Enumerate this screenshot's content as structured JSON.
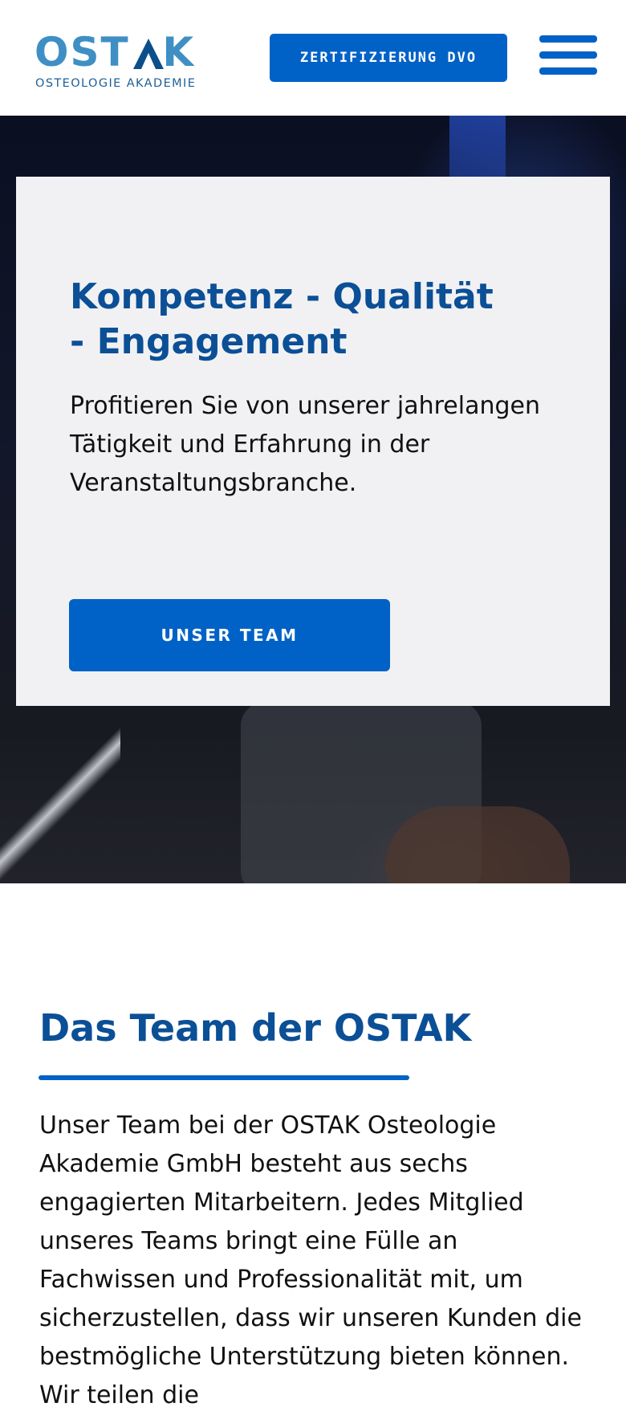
{
  "header": {
    "logo_word": "OSTAK",
    "logo_sub": "OSTEOLOGIE AKADEMIE",
    "cta_label": "ZERTIFIZIERUNG DVO",
    "menu_icon": "hamburger-menu-icon"
  },
  "hero": {
    "title": "Kompetenz - Qualität - Engagement",
    "text": "Profitieren Sie von unserer jahrelangen Tätigkeit und Erfahrung in der Veranstaltungsbranche.",
    "button_label": "UNSER TEAM"
  },
  "team": {
    "title": "Das Team der OSTAK",
    "text": "Unser Team bei der OSTAK Osteologie Akademie GmbH besteht aus sechs engagierten Mitarbeitern. Jedes Mitglied unseres Teams bringt eine Fülle an Fachwissen und Professionalität mit, um sicherzustellen, dass wir unseren Kunden die bestmögliche Unterstützung bieten können. Wir teilen die"
  },
  "colors": {
    "primary_blue": "#0062c6",
    "heading_blue": "#0b4f96",
    "logo_light_blue": "#3f8fc4",
    "card_bg": "#f1f1f3"
  }
}
